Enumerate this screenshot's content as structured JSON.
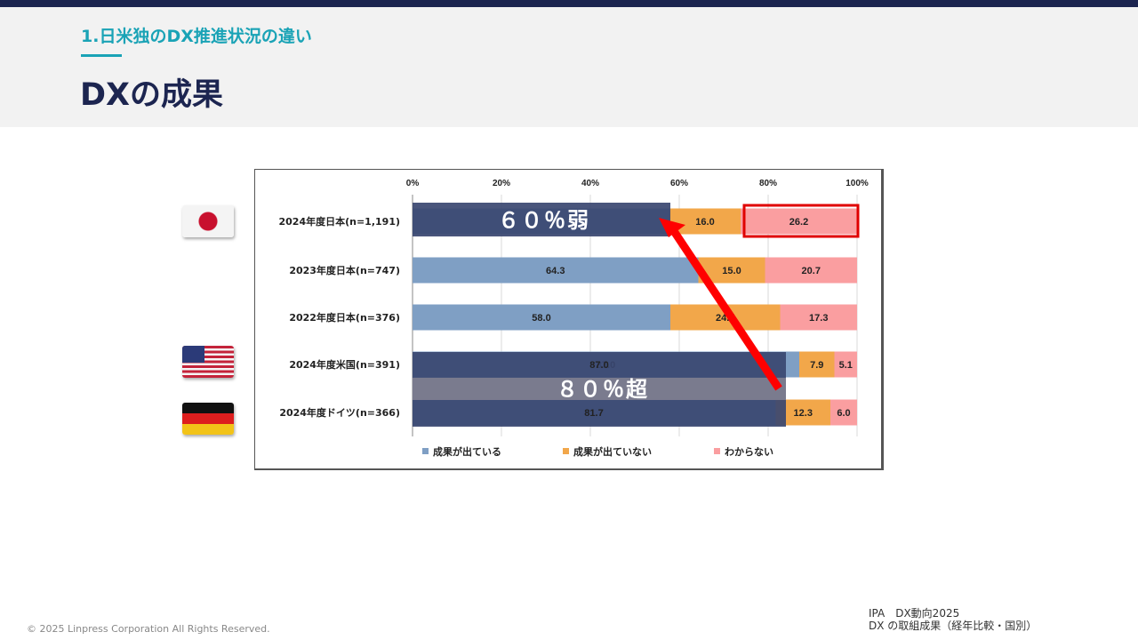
{
  "header": {
    "section": "1.日米独のDX推進状況の違い",
    "title": "DXの成果"
  },
  "chart_data": {
    "type": "bar",
    "orientation": "horizontal",
    "stacked": true,
    "categories": [
      "2024年度日本(n=1,191)",
      "2023年度日本(n=747)",
      "2022年度日本(n=376)",
      "2024年度米国(n=391)",
      "2024年度ドイツ(n=366)"
    ],
    "series": [
      {
        "name": "成果が出ている",
        "values": [
          57.8,
          64.3,
          58.0,
          87.0,
          81.7
        ],
        "labels": [
          "",
          "64.3",
          "58.0",
          "87.0",
          "81.7"
        ],
        "color": "#7f9fc4"
      },
      {
        "name": "成果が出ていない",
        "values": [
          16.0,
          15.0,
          24.7,
          7.9,
          12.3
        ],
        "labels": [
          "16.0",
          "15.0",
          "24.7",
          "7.9",
          "12.3"
        ],
        "color": "#f2a74a"
      },
      {
        "name": "わからない",
        "values": [
          26.2,
          20.7,
          17.3,
          5.1,
          6.0
        ],
        "labels": [
          "26.2",
          "20.7",
          "17.3",
          "5.1",
          "6.0"
        ],
        "color": "#fa9ea0"
      }
    ],
    "xticks": [
      "0%",
      "20%",
      "40%",
      "60%",
      "80%",
      "100%"
    ],
    "xlim": [
      0,
      100
    ],
    "grid": true,
    "legend": "bottom"
  },
  "annotations": {
    "jp_label": "６０％弱",
    "us_de_label": "８０％超",
    "overlay_color": "#3a4670",
    "arrow_color": "#ff0000",
    "highlight_color": "#e00000"
  },
  "flags": {
    "jp": "japan-flag-icon",
    "us": "usa-flag-icon",
    "de": "germany-flag-icon"
  },
  "footer": {
    "copyright": "© 2025 Linpress Corporation All Rights Reserved.",
    "source_line1": "IPA　DX動向2025",
    "source_line2": "DX の取組成果（経年比較・国別）"
  }
}
